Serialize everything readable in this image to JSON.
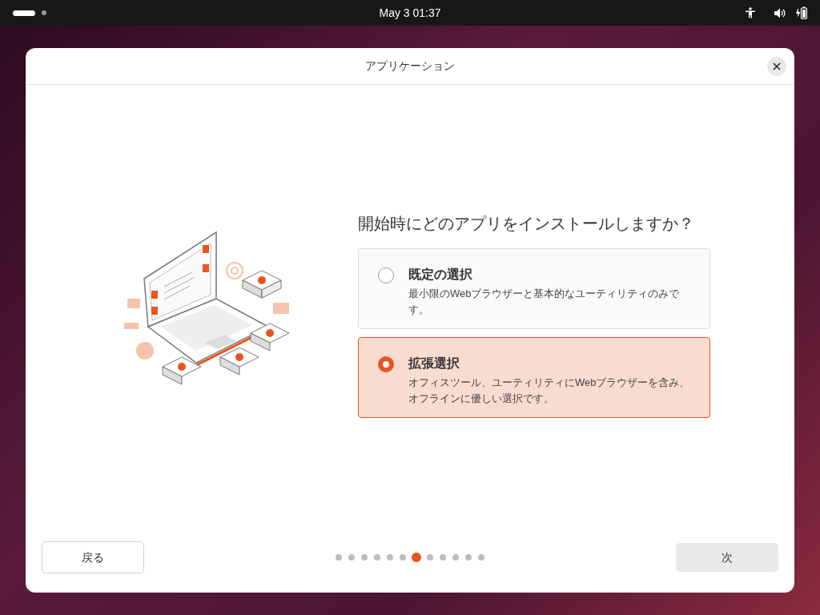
{
  "top_bar": {
    "clock": "May 3  01:37"
  },
  "dialog": {
    "title": "アプリケーション",
    "question": "開始時にどのアプリをインストールしますか？",
    "options": [
      {
        "title": "既定の選択",
        "description": "最小限のWebブラウザーと基本的なユーティリティのみです。",
        "selected": false
      },
      {
        "title": "拡張選択",
        "description": "オフィスツール、ユーティリティにWebブラウザーを含み、オフラインに優しい選択です。",
        "selected": true
      }
    ],
    "back_button": "戻る",
    "next_button": "次",
    "pages": [
      {
        "selected": false
      },
      {
        "selected": false
      },
      {
        "selected": false
      },
      {
        "selected": false
      },
      {
        "selected": false
      },
      {
        "selected": false
      },
      {
        "selected": true
      },
      {
        "selected": false
      },
      {
        "selected": false
      },
      {
        "selected": false
      },
      {
        "selected": false
      },
      {
        "selected": false
      }
    ]
  }
}
